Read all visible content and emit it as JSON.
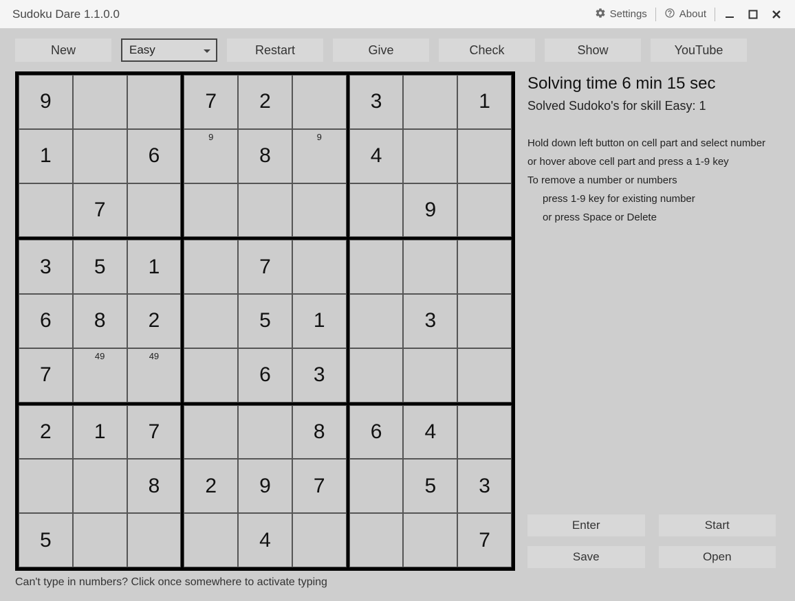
{
  "window": {
    "title": "Sudoku Dare 1.1.0.0",
    "settings_label": "Settings",
    "about_label": "About"
  },
  "toolbar": {
    "new_label": "New",
    "difficulty_selected": "Easy",
    "restart_label": "Restart",
    "give_label": "Give",
    "check_label": "Check",
    "show_label": "Show",
    "youtube_label": "YouTube"
  },
  "side": {
    "time_label": "Solving time 6 min 15 sec",
    "solved_label": "Solved Sudoko's for skill Easy: 1",
    "instr1": "Hold down left button on cell part and select number",
    "instr2": "or hover above cell part and press a 1-9 key",
    "instr3": "To remove a number or numbers",
    "instr4": "press 1-9 key for existing number",
    "instr5": "or press Space or Delete",
    "enter_label": "Enter",
    "start_label": "Start",
    "save_label": "Save",
    "open_label": "Open"
  },
  "footer": {
    "hint": "Can't type in numbers? Click once somewhere to activate typing"
  },
  "board": {
    "rows": [
      [
        {
          "v": "9"
        },
        {},
        {},
        {
          "v": "7"
        },
        {
          "v": "2"
        },
        {},
        {
          "v": "3"
        },
        {},
        {
          "v": "1"
        }
      ],
      [
        {
          "v": "1"
        },
        {},
        {
          "v": "6"
        },
        {
          "n": "9"
        },
        {
          "v": "8"
        },
        {
          "n": "9"
        },
        {
          "v": "4"
        },
        {},
        {}
      ],
      [
        {},
        {
          "v": "7"
        },
        {},
        {},
        {},
        {},
        {},
        {
          "v": "9"
        },
        {}
      ],
      [
        {
          "v": "3"
        },
        {
          "v": "5"
        },
        {
          "v": "1"
        },
        {},
        {
          "v": "7"
        },
        {},
        {},
        {},
        {}
      ],
      [
        {
          "v": "6"
        },
        {
          "v": "8"
        },
        {
          "v": "2"
        },
        {},
        {
          "v": "5"
        },
        {
          "v": "1"
        },
        {},
        {
          "v": "3"
        },
        {}
      ],
      [
        {
          "v": "7"
        },
        {
          "n": "49"
        },
        {
          "n": "49"
        },
        {},
        {
          "v": "6"
        },
        {
          "v": "3"
        },
        {},
        {},
        {}
      ],
      [
        {
          "v": "2"
        },
        {
          "v": "1"
        },
        {
          "v": "7"
        },
        {},
        {},
        {
          "v": "8"
        },
        {
          "v": "6"
        },
        {
          "v": "4"
        },
        {}
      ],
      [
        {},
        {},
        {
          "v": "8"
        },
        {
          "v": "2"
        },
        {
          "v": "9"
        },
        {
          "v": "7"
        },
        {},
        {
          "v": "5"
        },
        {
          "v": "3"
        }
      ],
      [
        {
          "v": "5"
        },
        {},
        {},
        {},
        {
          "v": "4"
        },
        {},
        {},
        {},
        {
          "v": "7"
        }
      ]
    ]
  }
}
